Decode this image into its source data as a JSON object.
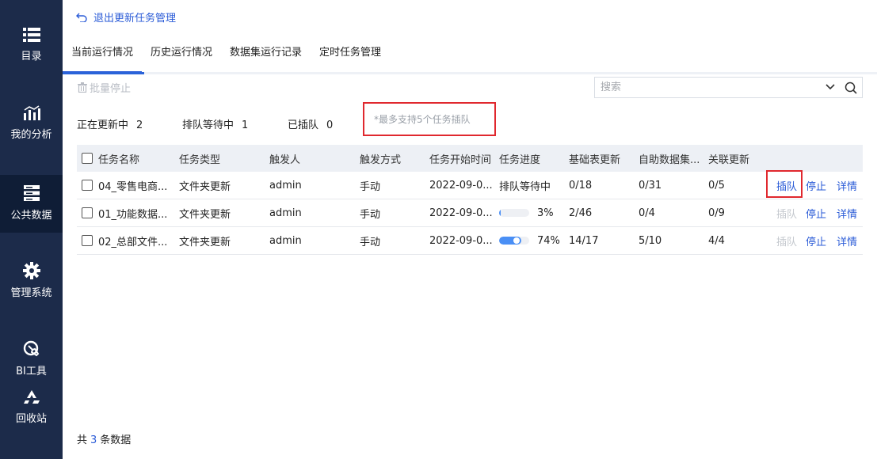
{
  "sidebar": {
    "items": [
      {
        "label": "目录",
        "icon": "list-icon"
      },
      {
        "label": "我的分析",
        "icon": "chart-icon"
      },
      {
        "label": "公共数据",
        "icon": "database-icon"
      },
      {
        "label": "管理系统",
        "icon": "gear-icon"
      },
      {
        "label": "BI工具",
        "icon": "wrench-icon"
      },
      {
        "label": "回收站",
        "icon": "recycle-icon"
      }
    ],
    "active": "公共数据"
  },
  "header": {
    "back_label": "退出更新任务管理"
  },
  "tabs": [
    {
      "label": "当前运行情况",
      "active": true
    },
    {
      "label": "历史运行情况",
      "active": false
    },
    {
      "label": "数据集运行记录",
      "active": false
    },
    {
      "label": "定时任务管理",
      "active": false
    }
  ],
  "toolbar": {
    "batch_stop_label": "批量停止",
    "search_placeholder": "搜索"
  },
  "stats": {
    "updating_label": "正在更新中",
    "updating_value": "2",
    "queued_label": "排队等待中",
    "queued_value": "1",
    "inserted_label": "已插队",
    "inserted_value": "0",
    "note": "*最多支持5个任务插队"
  },
  "table": {
    "headers": [
      "任务名称",
      "任务类型",
      "触发人",
      "触发方式",
      "任务开始时间",
      "任务进度",
      "基础表更新",
      "自助数据集...",
      "关联更新"
    ],
    "rows": [
      {
        "name": "04_零售电商...",
        "type": "文件夹更新",
        "trigger_user": "admin",
        "trigger_mode": "手动",
        "start_time": "2022-09-0...",
        "progress_text": "排队等待中",
        "base_update": "0/18",
        "self_dataset": "0/31",
        "related_update": "0/5",
        "actions": {
          "queue": "插队",
          "stop": "停止",
          "detail": "详情"
        },
        "queue_enabled": true
      },
      {
        "name": "01_功能数据...",
        "type": "文件夹更新",
        "trigger_user": "admin",
        "trigger_mode": "手动",
        "start_time": "2022-09-0...",
        "progress_pct": "3%",
        "progress_value": 0.03,
        "base_update": "2/46",
        "self_dataset": "0/4",
        "related_update": "0/9",
        "actions": {
          "queue": "插队",
          "stop": "停止",
          "detail": "详情"
        },
        "queue_enabled": false
      },
      {
        "name": "02_总部文件...",
        "type": "文件夹更新",
        "trigger_user": "admin",
        "trigger_mode": "手动",
        "start_time": "2022-09-0...",
        "progress_pct": "74%",
        "progress_value": 0.74,
        "base_update": "14/17",
        "self_dataset": "5/10",
        "related_update": "4/4",
        "actions": {
          "queue": "插队",
          "stop": "停止",
          "detail": "详情"
        },
        "queue_enabled": false
      }
    ]
  },
  "footer": {
    "prefix": "共",
    "count": "3",
    "suffix": "条数据"
  },
  "colors": {
    "sidebar_bg": "#1c2b4a",
    "accent": "#2a5bd7",
    "highlight_red": "#e0282e",
    "progress_blue": "#4a8ff5"
  }
}
